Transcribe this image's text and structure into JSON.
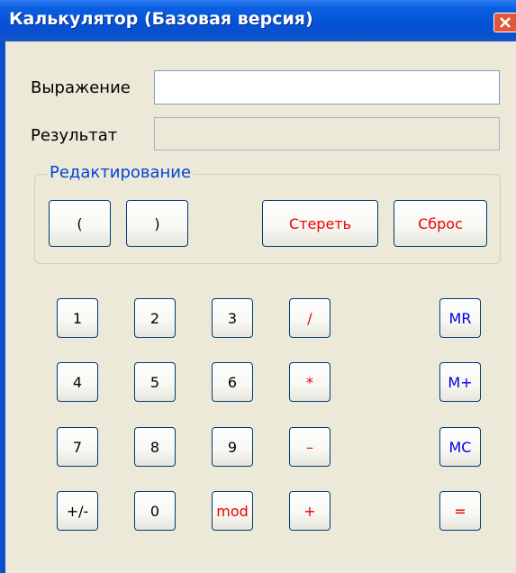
{
  "window": {
    "title": "Калькулятор (Базовая версия)"
  },
  "form": {
    "expression_label": "Выражение",
    "expression_value": "",
    "result_label": "Результат",
    "result_value": ""
  },
  "edit_group": {
    "title": "Редактирование",
    "open_paren": "(",
    "close_paren": ")",
    "erase": "Стереть",
    "reset": "Сброс"
  },
  "keypad": {
    "rows": [
      [
        "1",
        "2",
        "3",
        "/"
      ],
      [
        "4",
        "5",
        "6",
        "*"
      ],
      [
        "7",
        "8",
        "9",
        "–"
      ],
      [
        "+/-",
        "0",
        "mod",
        "+"
      ]
    ]
  },
  "memory": {
    "mr": "MR",
    "mplus": "M+",
    "mc": "MC",
    "equals": "="
  },
  "colors": {
    "title_bar": "#0553d6",
    "operator_text": "#ee0000",
    "memory_text": "#0000dd",
    "group_title": "#0046d5",
    "window_bg": "#ece9d8"
  }
}
